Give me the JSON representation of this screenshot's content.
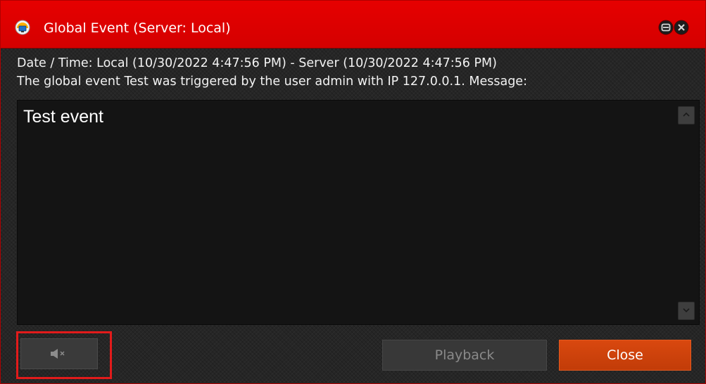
{
  "window": {
    "title": "Global Event (Server: Local)",
    "icons": {
      "app": "monitor-alert-icon",
      "minimize": "minimize-icon",
      "close": "close-icon"
    }
  },
  "info": {
    "datetime_line": "Date / Time: Local (10/30/2022 4:47:56 PM) - Server (10/30/2022 4:47:56 PM)",
    "event_line": "The global event Test was triggered by the user admin with IP 127.0.0.1. Message:"
  },
  "message": {
    "text": "Test event"
  },
  "scrollbar": {
    "up_icon": "chevron-up-icon",
    "down_icon": "chevron-down-icon"
  },
  "actions": {
    "mute_icon": "speaker-mute-icon",
    "playback_label": "Playback",
    "close_label": "Close"
  },
  "colors": {
    "titlebar": "#e00000",
    "close_button": "#d0440c",
    "highlight": "#e21b1b"
  }
}
